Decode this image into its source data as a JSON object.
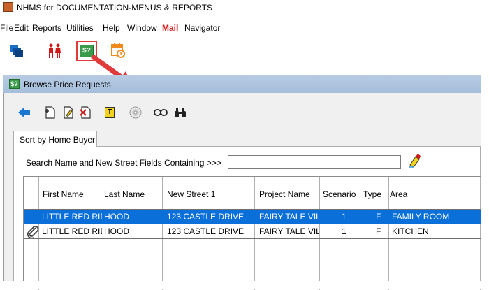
{
  "app": {
    "title": "NHMS for DOCUMENTATION-MENUS & REPORTS"
  },
  "menu": [
    "File",
    "Edit",
    "Reports",
    "Utilities",
    "Help",
    "Window",
    "Mail",
    "Navigator"
  ],
  "toolbar": {
    "icons": [
      "windows-icon",
      "people-icon",
      "price-request-icon",
      "calendar-clock-icon"
    ],
    "price_request_glyph": "$?"
  },
  "window": {
    "title": "Browse Price Requests",
    "icon_glyph": "$?",
    "toolbar_icons": [
      "back-arrow-icon",
      "add-record-icon",
      "edit-record-icon",
      "delete-record-icon",
      "notes-icon",
      "disc-icon",
      "link-icon",
      "binoculars-icon"
    ],
    "notes_glyph": "T"
  },
  "tab": {
    "label": "Sort by Home Buyer"
  },
  "search": {
    "label": "Search Name and New Street Fields Containing >>>",
    "value": "",
    "placeholder": ""
  },
  "grid": {
    "columns": [
      "First Name",
      "Last Name",
      "New Street 1",
      "Project Name",
      "Scenario",
      "Type",
      "Area"
    ],
    "rows": [
      {
        "selected": true,
        "attachment": false,
        "cells": [
          "LITTLE RED RIDIN",
          "HOOD",
          "123 CASTLE DRIVE",
          "FAIRY TALE VILL",
          "1",
          "F",
          "FAMILY ROOM"
        ]
      },
      {
        "selected": false,
        "attachment": true,
        "cells": [
          "LITTLE RED RIDIN",
          "HOOD",
          "123 CASTLE DRIVE",
          "FAIRY TALE VILL",
          "1",
          "F",
          "KITCHEN"
        ]
      }
    ]
  },
  "colors": {
    "accent_red": "#e03a3a",
    "selection": "#0a6fd8",
    "window_title": "#b7cbe3"
  }
}
